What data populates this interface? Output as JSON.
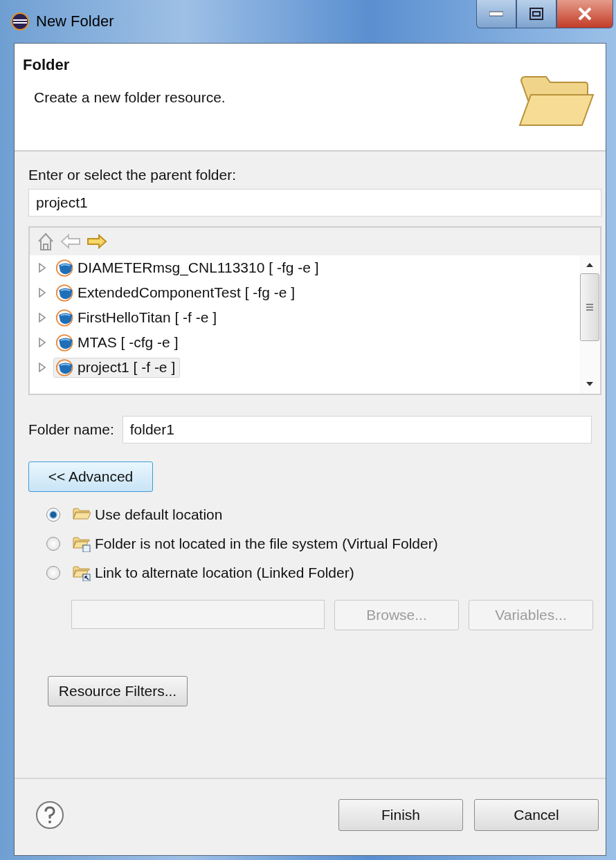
{
  "window": {
    "title": "New Folder"
  },
  "header": {
    "title": "Folder",
    "description": "Create a new folder resource."
  },
  "parent_folder": {
    "label": "Enter or select the parent folder:",
    "value": "project1"
  },
  "tree": {
    "items": [
      {
        "label": "DIAMETERmsg_CNL113310 [ -fg -e ]",
        "expanded": false,
        "selected": false
      },
      {
        "label": "ExtendedComponentTest [ -fg -e ]",
        "expanded": false,
        "selected": false
      },
      {
        "label": "FirstHelloTitan [ -f -e ]",
        "expanded": false,
        "selected": false
      },
      {
        "label": "MTAS [ -cfg -e ]",
        "expanded": false,
        "selected": false
      },
      {
        "label": "project1 [ -f -e ]",
        "expanded": false,
        "selected": true
      }
    ]
  },
  "folder_name": {
    "label": "Folder name:",
    "value": "folder1"
  },
  "advanced_button": "<< Advanced",
  "location_options": [
    {
      "kind": "default",
      "label": "Use default location",
      "selected": true
    },
    {
      "kind": "virtual",
      "label": "Folder is not located in the file system (Virtual Folder)",
      "selected": false
    },
    {
      "kind": "linked",
      "label": "Link to alternate location (Linked Folder)",
      "selected": false
    }
  ],
  "location": {
    "disabled": true,
    "buttons": [
      {
        "label": "Browse...",
        "disabled": true
      },
      {
        "label": "Variables...",
        "disabled": true
      }
    ]
  },
  "resource_filters_button": "Resource Filters...",
  "buttons": [
    {
      "label": "Finish"
    },
    {
      "label": "Cancel"
    }
  ]
}
